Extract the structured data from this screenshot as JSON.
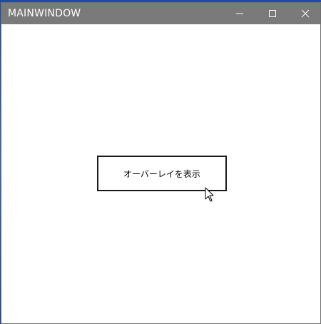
{
  "window": {
    "title": "MAINWINDOW",
    "titlebar_color": "#7a7a7a",
    "controls": {
      "minimize_icon": "minimize-icon",
      "maximize_icon": "maximize-icon",
      "close_icon": "close-icon"
    }
  },
  "main": {
    "overlay_button_label": "オーバーレイを表示"
  },
  "cursor": {
    "icon": "mouse-pointer-icon"
  }
}
